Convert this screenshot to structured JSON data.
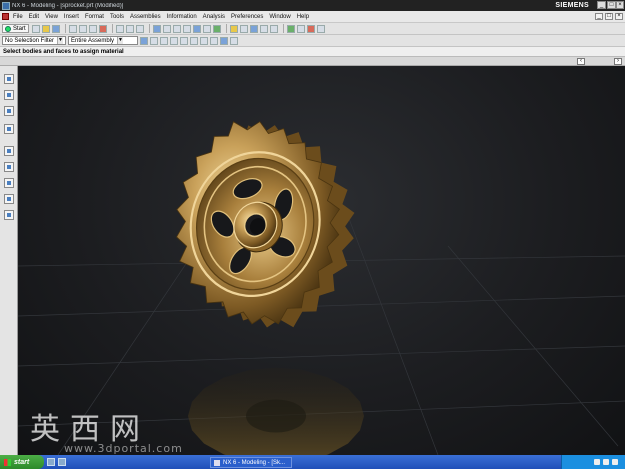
{
  "window": {
    "title": "NX 6 - Modeling - [sprocket.prt (Modified)]",
    "brand": "SIEMENS",
    "controls": [
      "_",
      "□",
      "×"
    ]
  },
  "menubar": {
    "items": [
      "File",
      "Edit",
      "View",
      "Insert",
      "Format",
      "Tools",
      "Assemblies",
      "Information",
      "Analysis",
      "Preferences",
      "Window",
      "Help"
    ]
  },
  "toolbar": {
    "start_label": "Start",
    "selection_filter": "No Selection Filter",
    "scope": "Entire Assembly"
  },
  "cue_line": "Select bodies and faces to assign material",
  "watermark": {
    "logo": "英西网",
    "url": "www.3dportal.com"
  },
  "taskbar": {
    "start_label": "start",
    "task_label": "NX 6 - Modeling - [Sk..."
  },
  "colors": {
    "background": "#1c1d20",
    "gear_gold": "#c9a15a",
    "taskbar": "#245edb"
  }
}
